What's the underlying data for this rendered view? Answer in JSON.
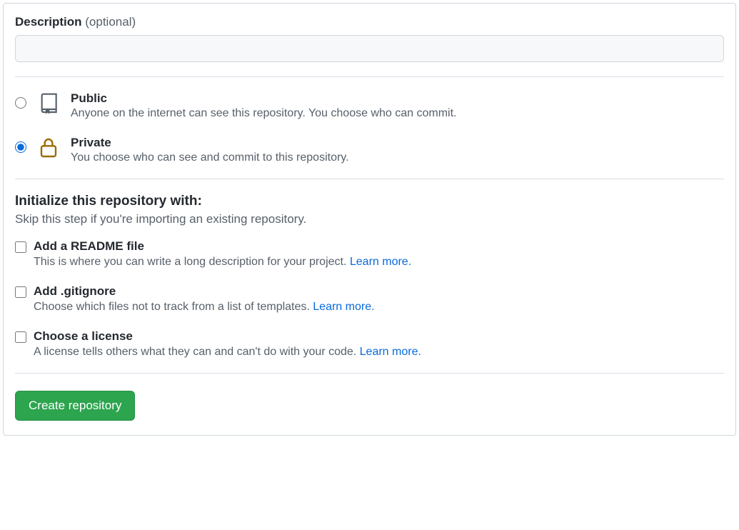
{
  "description": {
    "label": "Description",
    "optional": "(optional)",
    "value": ""
  },
  "visibility": {
    "public": {
      "title": "Public",
      "desc": "Anyone on the internet can see this repository. You choose who can commit."
    },
    "private": {
      "title": "Private",
      "desc": "You choose who can see and commit to this repository."
    }
  },
  "init": {
    "heading": "Initialize this repository with:",
    "subtext": "Skip this step if you're importing an existing repository.",
    "readme": {
      "title": "Add a README file",
      "desc": "This is where you can write a long description for your project. ",
      "link": "Learn more."
    },
    "gitignore": {
      "title": "Add .gitignore",
      "desc": "Choose which files not to track from a list of templates. ",
      "link": "Learn more."
    },
    "license": {
      "title": "Choose a license",
      "desc": "A license tells others what they can and can't do with your code. ",
      "link": "Learn more."
    }
  },
  "submit": {
    "label": "Create repository"
  }
}
